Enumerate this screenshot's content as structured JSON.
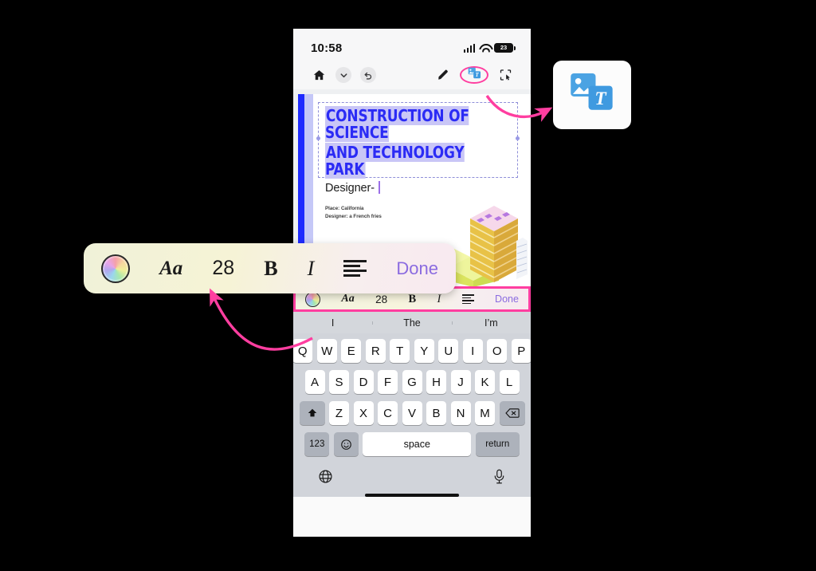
{
  "device": {
    "status_bar": {
      "time": "10:58",
      "battery_level": "23",
      "signal_icon": "cellular-signal-icon",
      "wifi_icon": "wifi-icon",
      "battery_icon": "battery-icon"
    },
    "home_indicator": "home-indicator"
  },
  "app_toolbar": {
    "left": [
      {
        "name": "home-button",
        "icon": "home-icon"
      },
      {
        "name": "chevron-down-button",
        "icon": "chevron-down-icon"
      },
      {
        "name": "undo-button",
        "icon": "undo-arrow-icon"
      }
    ],
    "right": [
      {
        "name": "pen-tool-button",
        "icon": "pen-icon"
      },
      {
        "name": "insert-image-text-button",
        "icon": "image-text-icon",
        "highlighted": true
      },
      {
        "name": "crop-select-button",
        "icon": "crop-pointer-icon"
      }
    ]
  },
  "document": {
    "title_line_1": "CONSTRUCTION OF SCIENCE",
    "title_line_2": "AND TECHNOLOGY PARK",
    "designer_label": "Designer-",
    "meta_line_1": "Place:  California",
    "meta_line_2": "Designer: a French fries",
    "title_color": "#2b2bf5",
    "title_highlight_color": "#c9c6f6",
    "accent_bar_color": "#1f2bff",
    "caret_color": "#9b6fe8",
    "illustration": "isometric-building-illustration"
  },
  "format_toolbar": {
    "color_wheel": "color-wheel-icon",
    "font_label": "Aa",
    "font_size": "28",
    "bold_label": "B",
    "italic_label": "I",
    "align_icon": "text-align-icon",
    "done_label": "Done",
    "done_color": "#8b6be0"
  },
  "predictive_bar": {
    "suggestions": [
      "I",
      "The",
      "I’m"
    ]
  },
  "keyboard": {
    "row1": [
      "Q",
      "W",
      "E",
      "R",
      "T",
      "Y",
      "U",
      "I",
      "O",
      "P"
    ],
    "row2": [
      "A",
      "S",
      "D",
      "F",
      "G",
      "H",
      "J",
      "K",
      "L"
    ],
    "row3": [
      "Z",
      "X",
      "C",
      "V",
      "B",
      "N",
      "M"
    ],
    "shift_icon": "shift-up-arrow-icon",
    "backspace_icon": "backspace-icon",
    "numbers_label": "123",
    "emoji_icon": "emoji-smiley-icon",
    "space_label": "space",
    "return_label": "return",
    "globe_icon": "globe-icon",
    "microphone_icon": "microphone-icon"
  },
  "annotations": {
    "highlight_color": "#ff3ea0",
    "callout_icon_name": "image-text-icon-zoomed",
    "arrow_1": "arrow-toolbar-icon-to-card",
    "arrow_2": "arrow-format-bar-to-callout"
  }
}
